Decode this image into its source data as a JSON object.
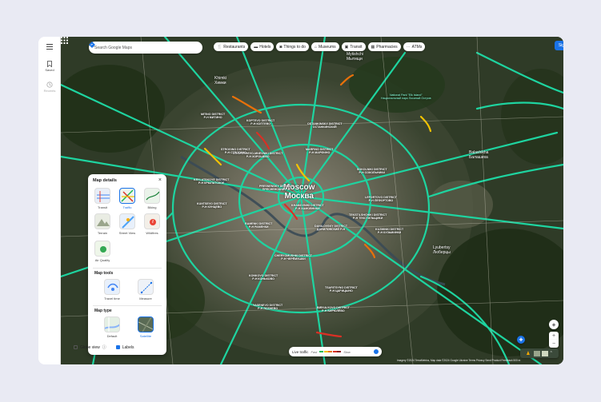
{
  "rail": {
    "saved_label": "Saved",
    "recents_label": "Recents"
  },
  "search": {
    "placeholder": "Search Google Maps"
  },
  "chips": [
    {
      "label": "Restaurants",
      "icon": "restaurant-icon"
    },
    {
      "label": "Hotels",
      "icon": "hotel-icon"
    },
    {
      "label": "Things to do",
      "icon": "camera-icon"
    },
    {
      "label": "Museums",
      "icon": "museum-icon"
    },
    {
      "label": "Transit",
      "icon": "transit-icon"
    },
    {
      "label": "Pharmacies",
      "icon": "pharmacy-icon"
    },
    {
      "label": "ATMs",
      "icon": "more-icon"
    }
  ],
  "header": {
    "signin_label": "Sign in"
  },
  "panel": {
    "title": "Map details",
    "details": [
      {
        "label": "Transit",
        "selected": false
      },
      {
        "label": "Traffic",
        "selected": true
      },
      {
        "label": "Biking",
        "selected": false
      },
      {
        "label": "Terrain",
        "selected": false
      },
      {
        "label": "Street View",
        "selected": false
      },
      {
        "label": "Wildfires",
        "selected": false
      },
      {
        "label": "Air Quality",
        "selected": false
      }
    ],
    "tools_title": "Map tools",
    "tools": [
      {
        "label": "Travel time"
      },
      {
        "label": "Measure"
      }
    ],
    "type_title": "Map type",
    "types": [
      {
        "label": "Default",
        "selected": false
      },
      {
        "label": "Satellite",
        "selected": true
      }
    ],
    "globe_label": "Globe view",
    "globe_checked": false,
    "labels_label": "Labels",
    "labels_checked": true
  },
  "traffic": {
    "title": "Live traffic",
    "fast": "Fast",
    "slow": "Slow",
    "colors": [
      "#1db954",
      "#f2c200",
      "#e8710a",
      "#d93025",
      "#8b1a1a"
    ]
  },
  "footer": {
    "text": "Imagery ©2024 TerraMetrics, Map data ©2024 Google   Ukraine   Terms   Privacy   Send Product Feedback   500 m"
  },
  "map": {
    "city_en": "Moscow",
    "city_ru": "Москва",
    "districts": [
      {
        "en": "Khimki",
        "ru": "Химки"
      },
      {
        "en": "Mytishchi",
        "ru": "Мытищи"
      },
      {
        "en": "Balashikha",
        "ru": "Балашиха"
      },
      {
        "en": "Lyubertsy",
        "ru": "Люберцы"
      },
      {
        "en": "KOPTEVO DISTRICT",
        "ru": "Р-Н КОПТЕВО"
      },
      {
        "en": "OSTANKINSKY DISTRICT",
        "ru": "ОСТАНКИНСКИЙ"
      },
      {
        "en": "MARFINO DISTRICT",
        "ru": "Р-Н МАРФИНО"
      },
      {
        "en": "SOKOLNIKI DISTRICT",
        "ru": "Р-Н СОКОЛЬНИКИ"
      },
      {
        "en": "KHOROSHEVO-MNEVNIKI DISTRICT",
        "ru": "Р-Н ХОРОШЕВО"
      },
      {
        "en": "PRESNENSKY DISTRICT",
        "ru": "ПРЕСНЕНСКИЙ Р-Н"
      },
      {
        "en": "KHAMOVNIKI DISTRICT",
        "ru": "Р-Н ХАМОВНИКИ"
      },
      {
        "en": "LEFORTOVO DISTRICT",
        "ru": "Р-Н ЛЕФОРТОВО"
      },
      {
        "en": "KUZMINKI DISTRICT",
        "ru": "Р-Н КУЗЬМИНКИ"
      },
      {
        "en": "DANILOVSKY DISTRICT",
        "ru": "ДАНИЛОВСКИЙ Р-Н"
      },
      {
        "en": "RAMENKI DISTRICT",
        "ru": "Р-Н РАМЕНКИ"
      },
      {
        "en": "CHERYOMUSHKI DISTRICT",
        "ru": "Р-Н ЧЕРЁМУШКИ"
      },
      {
        "en": "KONKOVO DISTRICT",
        "ru": "Р-Н КОНЬКОВО"
      },
      {
        "en": "TSARITSYNO DISTRICT",
        "ru": "Р-Н ЦАРИЦЫНО"
      },
      {
        "en": "YASENEVO DISTRICT",
        "ru": "Р-Н ЯСЕНЕВО"
      },
      {
        "en": "BIRYULYOVO DISTRICT",
        "ru": "Р-Н БИРЮЛЁВО"
      },
      {
        "en": "KRYLATSKOYE DISTRICT",
        "ru": "Р-Н КРЫЛАТСКОЕ"
      },
      {
        "en": "KUNTSEVO DISTRICT",
        "ru": "Р-Н КУНЦЕВО"
      },
      {
        "en": "MITINO DISTRICT",
        "ru": "Р-Н МИТИНО"
      },
      {
        "en": "STROGINO DISTRICT",
        "ru": "Р-Н СТРОГИНО"
      },
      {
        "en": "TEKSTILSHCHIKI DISTRICT",
        "ru": "Р-Н ТЕКСТИЛЬЩИКИ"
      }
    ],
    "park": "National Park \"Elk Island\"",
    "park_ru": "Национальный парк Лосиный Остров"
  }
}
